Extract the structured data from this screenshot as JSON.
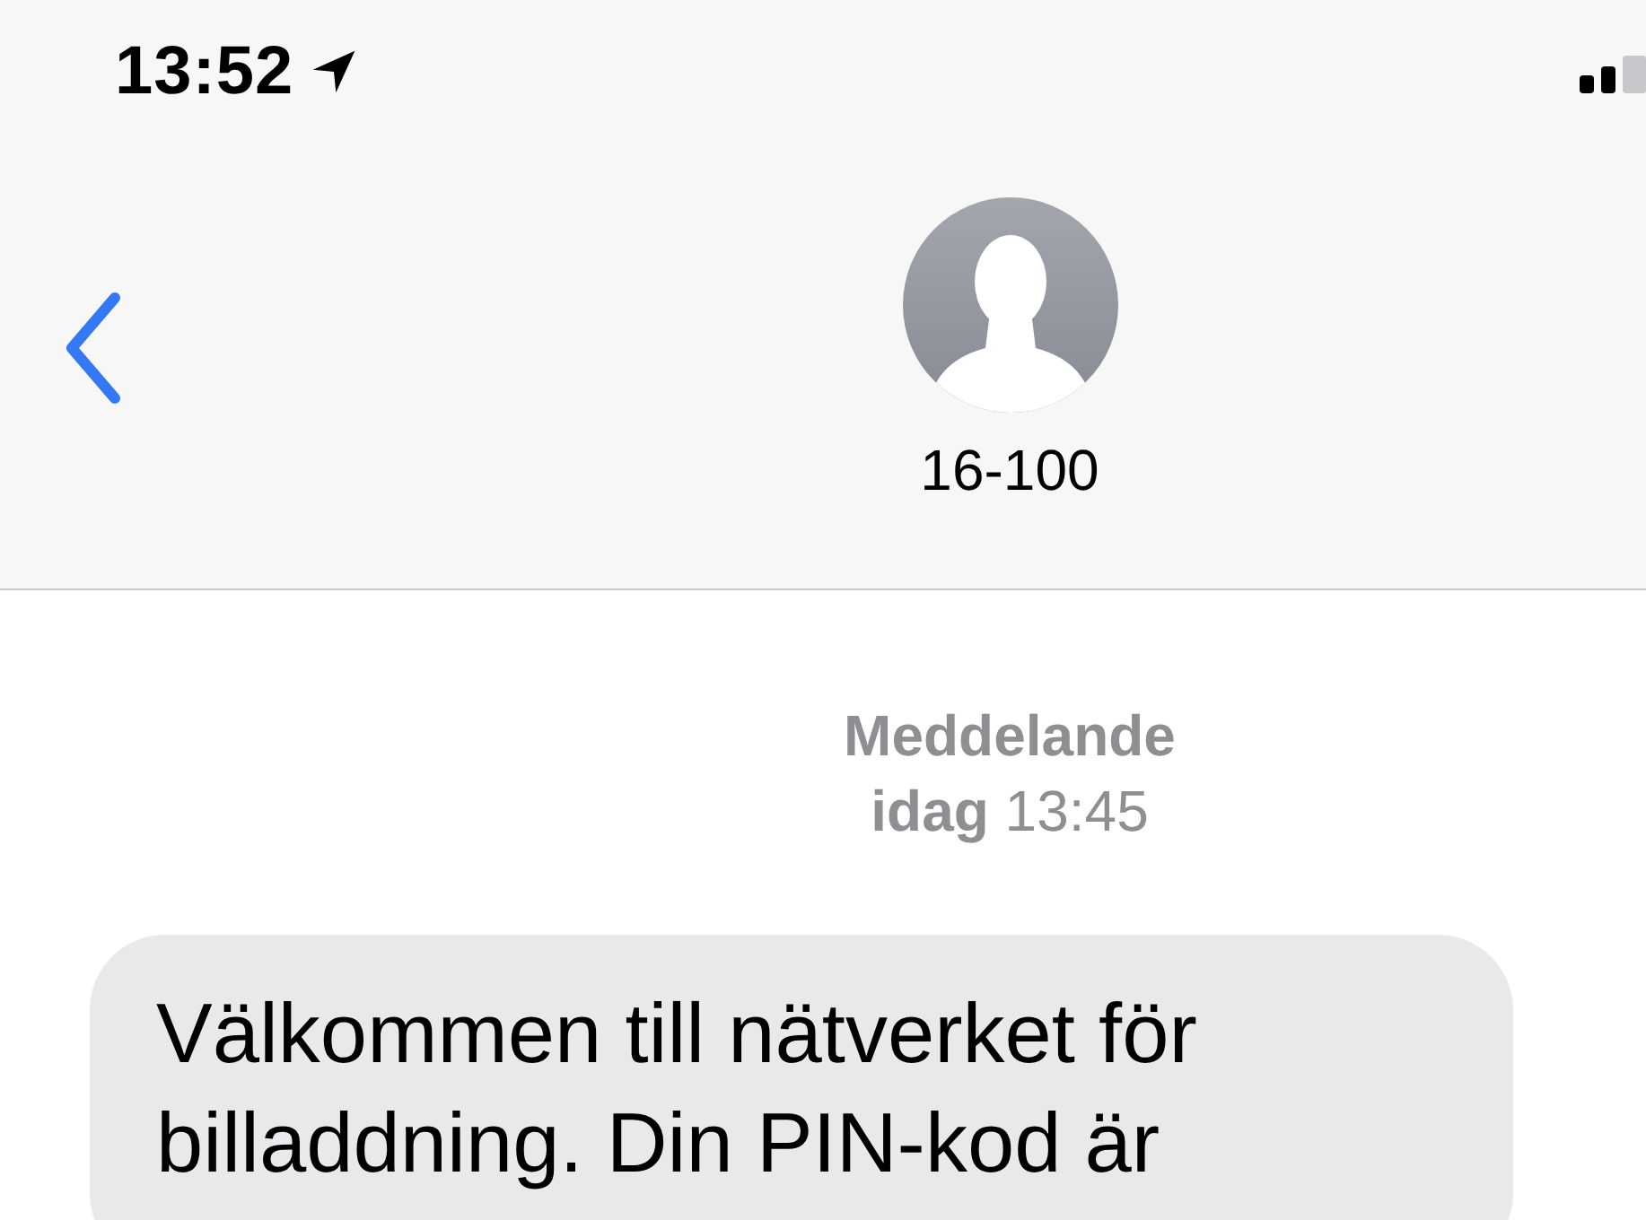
{
  "status_bar": {
    "time": "13:52"
  },
  "header": {
    "contact_name": "16-100"
  },
  "thread": {
    "service": "Meddelande",
    "timestamp": "**idag** 13:45",
    "messages": [
      {
        "kind": "incoming",
        "text": "Välkommen till nätverket för billaddning. Din PIN-kod är"
      }
    ]
  }
}
